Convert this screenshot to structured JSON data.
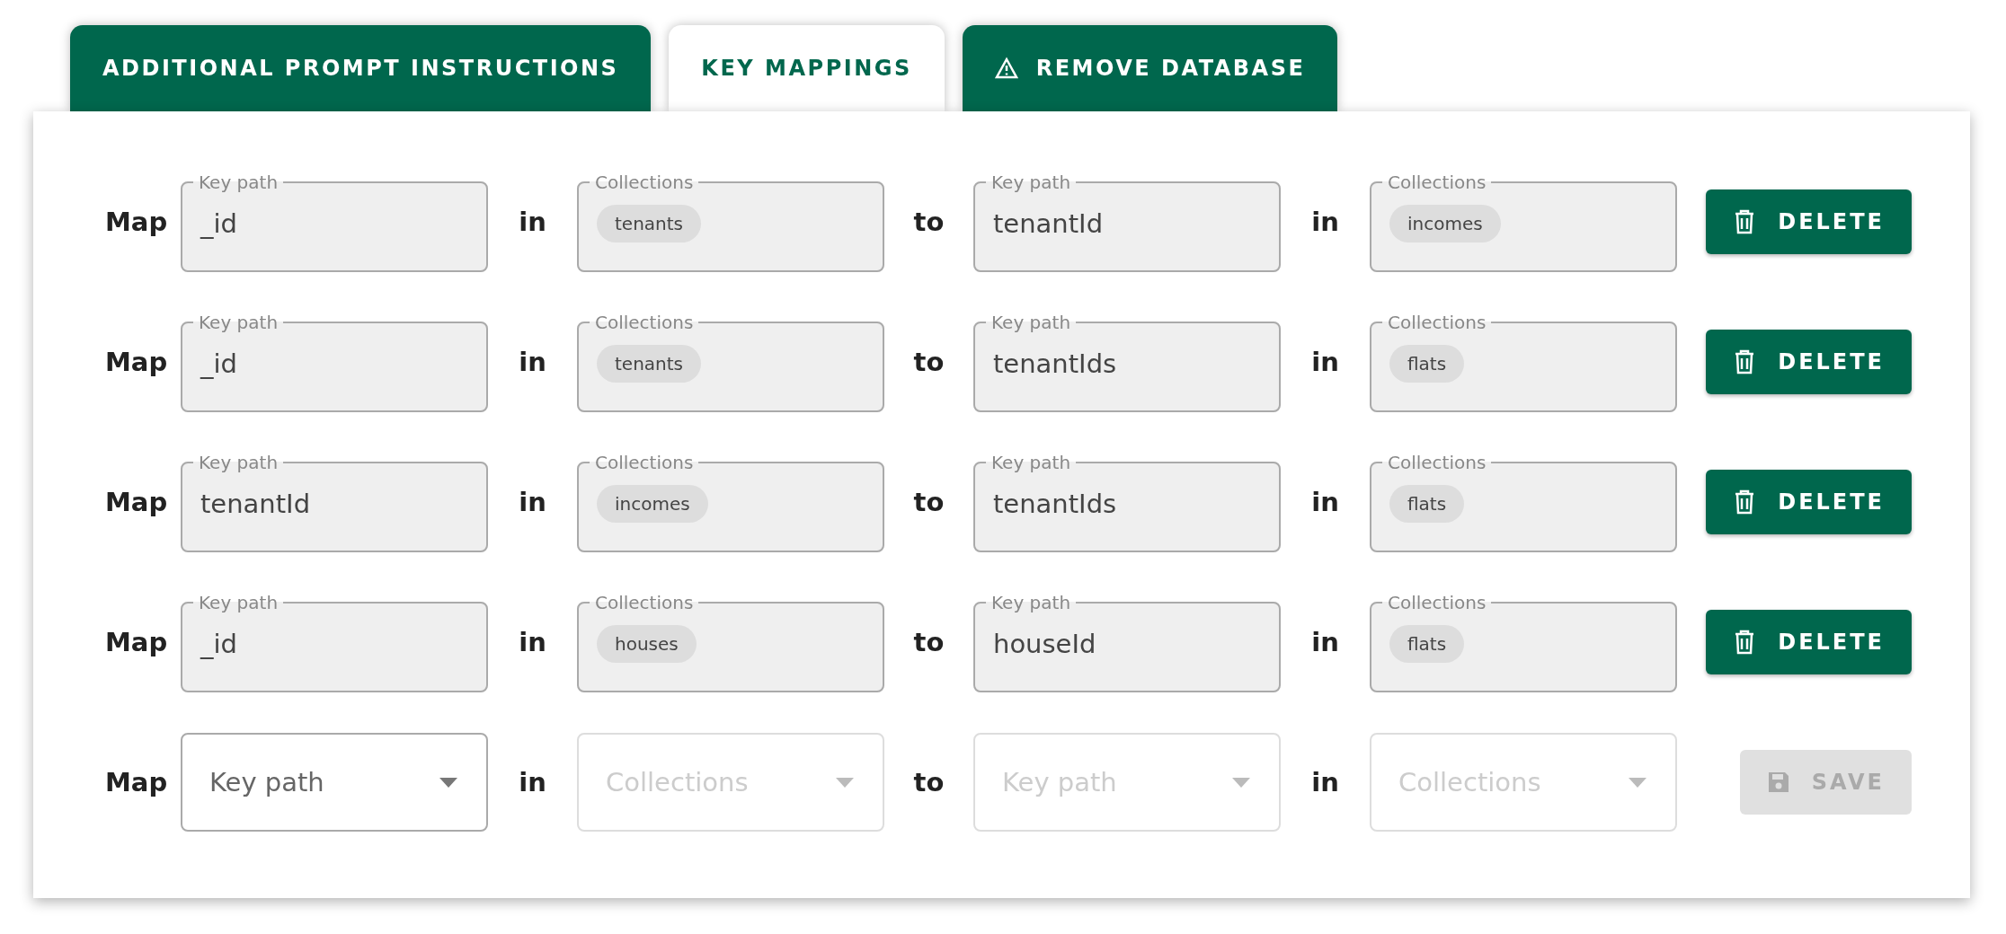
{
  "tabs": [
    {
      "label": "ADDITIONAL PROMPT INSTRUCTIONS",
      "selected": false,
      "kind": "plain"
    },
    {
      "label": "KEY MAPPINGS",
      "selected": true,
      "kind": "plain"
    },
    {
      "label": "REMOVE DATABASE",
      "selected": false,
      "kind": "warning"
    }
  ],
  "mappings": [
    {
      "parts": [
        {
          "kind": "word",
          "text": "Map"
        },
        {
          "kind": "key",
          "label": "Key path",
          "value": "_id"
        },
        {
          "kind": "word",
          "text": "in"
        },
        {
          "kind": "collections",
          "label": "Collections",
          "chips": [
            "tenants"
          ]
        },
        {
          "kind": "word",
          "text": "to"
        },
        {
          "kind": "key",
          "label": "Key path",
          "value": "tenantId"
        },
        {
          "kind": "word",
          "text": "in"
        },
        {
          "kind": "collections",
          "label": "Collections",
          "chips": [
            "incomes"
          ]
        }
      ],
      "button": {
        "label": "DELETE",
        "kind": "delete",
        "disabled": false
      }
    },
    {
      "parts": [
        {
          "kind": "word",
          "text": "Map"
        },
        {
          "kind": "key",
          "label": "Key path",
          "value": "_id"
        },
        {
          "kind": "word",
          "text": "in"
        },
        {
          "kind": "collections",
          "label": "Collections",
          "chips": [
            "tenants"
          ]
        },
        {
          "kind": "word",
          "text": "to"
        },
        {
          "kind": "key",
          "label": "Key path",
          "value": "tenantIds"
        },
        {
          "kind": "word",
          "text": "in"
        },
        {
          "kind": "collections",
          "label": "Collections",
          "chips": [
            "flats"
          ]
        }
      ],
      "button": {
        "label": "DELETE",
        "kind": "delete",
        "disabled": false
      }
    },
    {
      "parts": [
        {
          "kind": "word",
          "text": "Map"
        },
        {
          "kind": "key",
          "label": "Key path",
          "value": "tenantId"
        },
        {
          "kind": "word",
          "text": "in"
        },
        {
          "kind": "collections",
          "label": "Collections",
          "chips": [
            "incomes"
          ]
        },
        {
          "kind": "word",
          "text": "to"
        },
        {
          "kind": "key",
          "label": "Key path",
          "value": "tenantIds"
        },
        {
          "kind": "word",
          "text": "in"
        },
        {
          "kind": "collections",
          "label": "Collections",
          "chips": [
            "flats"
          ]
        }
      ],
      "button": {
        "label": "DELETE",
        "kind": "delete",
        "disabled": false
      }
    },
    {
      "parts": [
        {
          "kind": "word",
          "text": "Map"
        },
        {
          "kind": "key",
          "label": "Key path",
          "value": "_id"
        },
        {
          "kind": "word",
          "text": "in"
        },
        {
          "kind": "collections",
          "label": "Collections",
          "chips": [
            "houses"
          ]
        },
        {
          "kind": "word",
          "text": "to"
        },
        {
          "kind": "key",
          "label": "Key path",
          "value": "houseId"
        },
        {
          "kind": "word",
          "text": "in"
        },
        {
          "kind": "collections",
          "label": "Collections",
          "chips": [
            "flats"
          ]
        }
      ],
      "button": {
        "label": "DELETE",
        "kind": "delete",
        "disabled": false
      }
    },
    {
      "parts": [
        {
          "kind": "word",
          "text": "Map"
        },
        {
          "kind": "select",
          "placeholder": "Key path",
          "disabled": false
        },
        {
          "kind": "word",
          "text": "in"
        },
        {
          "kind": "select",
          "placeholder": "Collections",
          "disabled": true
        },
        {
          "kind": "word",
          "text": "to"
        },
        {
          "kind": "select",
          "placeholder": "Key path",
          "disabled": true
        },
        {
          "kind": "word",
          "text": "in"
        },
        {
          "kind": "select",
          "placeholder": "Collections",
          "disabled": true
        }
      ],
      "button": {
        "label": "SAVE",
        "kind": "save",
        "disabled": true
      }
    }
  ]
}
